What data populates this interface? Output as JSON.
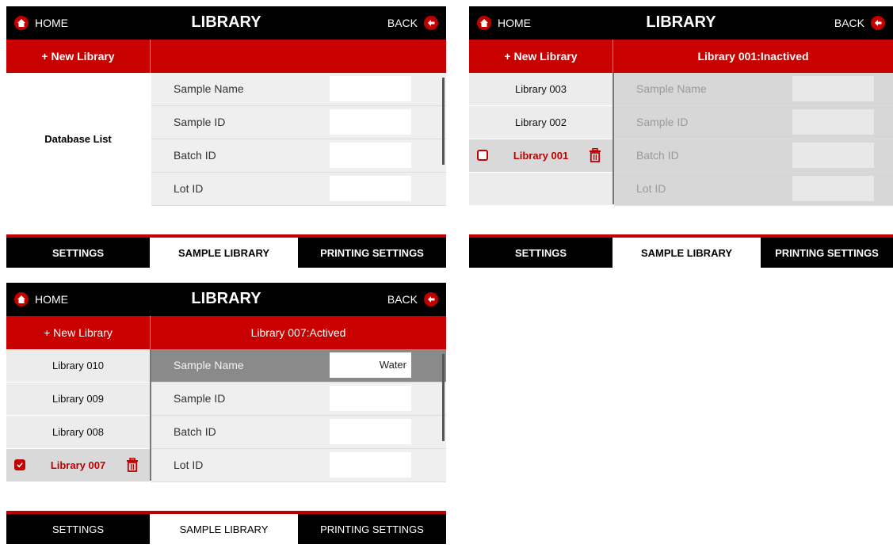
{
  "colors": {
    "header": "#000000",
    "accent": "#c80000",
    "row_bg": "#efefef",
    "highlight_row": "#8a8a8a"
  },
  "panels": [
    {
      "header": {
        "home_label": "HOME",
        "title": "LIBRARY",
        "back_label": "BACK"
      },
      "new_library_label": "+ New Library",
      "library_status": "",
      "database_list_label": "Database  List",
      "fields": [
        {
          "label": "Sample Name",
          "value": ""
        },
        {
          "label": "Sample ID",
          "value": ""
        },
        {
          "label": "Batch ID",
          "value": ""
        },
        {
          "label": "Lot ID",
          "value": ""
        }
      ],
      "tabs": [
        "SETTINGS",
        "SAMPLE LIBRARY",
        "PRINTING SETTINGS"
      ]
    },
    {
      "header": {
        "home_label": "HOME",
        "title": "LIBRARY",
        "back_label": "BACK"
      },
      "new_library_label": "+ New Library",
      "library_status": "Library 001:Inactived",
      "libraries": [
        "Library 003",
        "Library 002",
        "Library 001"
      ],
      "fields": [
        {
          "label": "Sample Name",
          "value": ""
        },
        {
          "label": "Sample ID",
          "value": ""
        },
        {
          "label": "Batch ID",
          "value": ""
        },
        {
          "label": "Lot ID",
          "value": ""
        }
      ],
      "tabs": [
        "SETTINGS",
        "SAMPLE LIBRARY",
        "PRINTING SETTINGS"
      ]
    },
    {
      "header": {
        "home_label": "HOME",
        "title": "LIBRARY",
        "back_label": "BACK"
      },
      "new_library_label": "+ New Library",
      "library_status": "Library 007:Actived",
      "libraries": [
        "Library 010",
        "Library 009",
        "Library 008",
        "Library 007"
      ],
      "fields": [
        {
          "label": "Sample Name",
          "value": "Water"
        },
        {
          "label": "Sample ID",
          "value": ""
        },
        {
          "label": "Batch ID",
          "value": ""
        },
        {
          "label": "Lot ID",
          "value": ""
        }
      ],
      "tabs": [
        "SETTINGS",
        "SAMPLE LIBRARY",
        "PRINTING SETTINGS"
      ]
    }
  ]
}
